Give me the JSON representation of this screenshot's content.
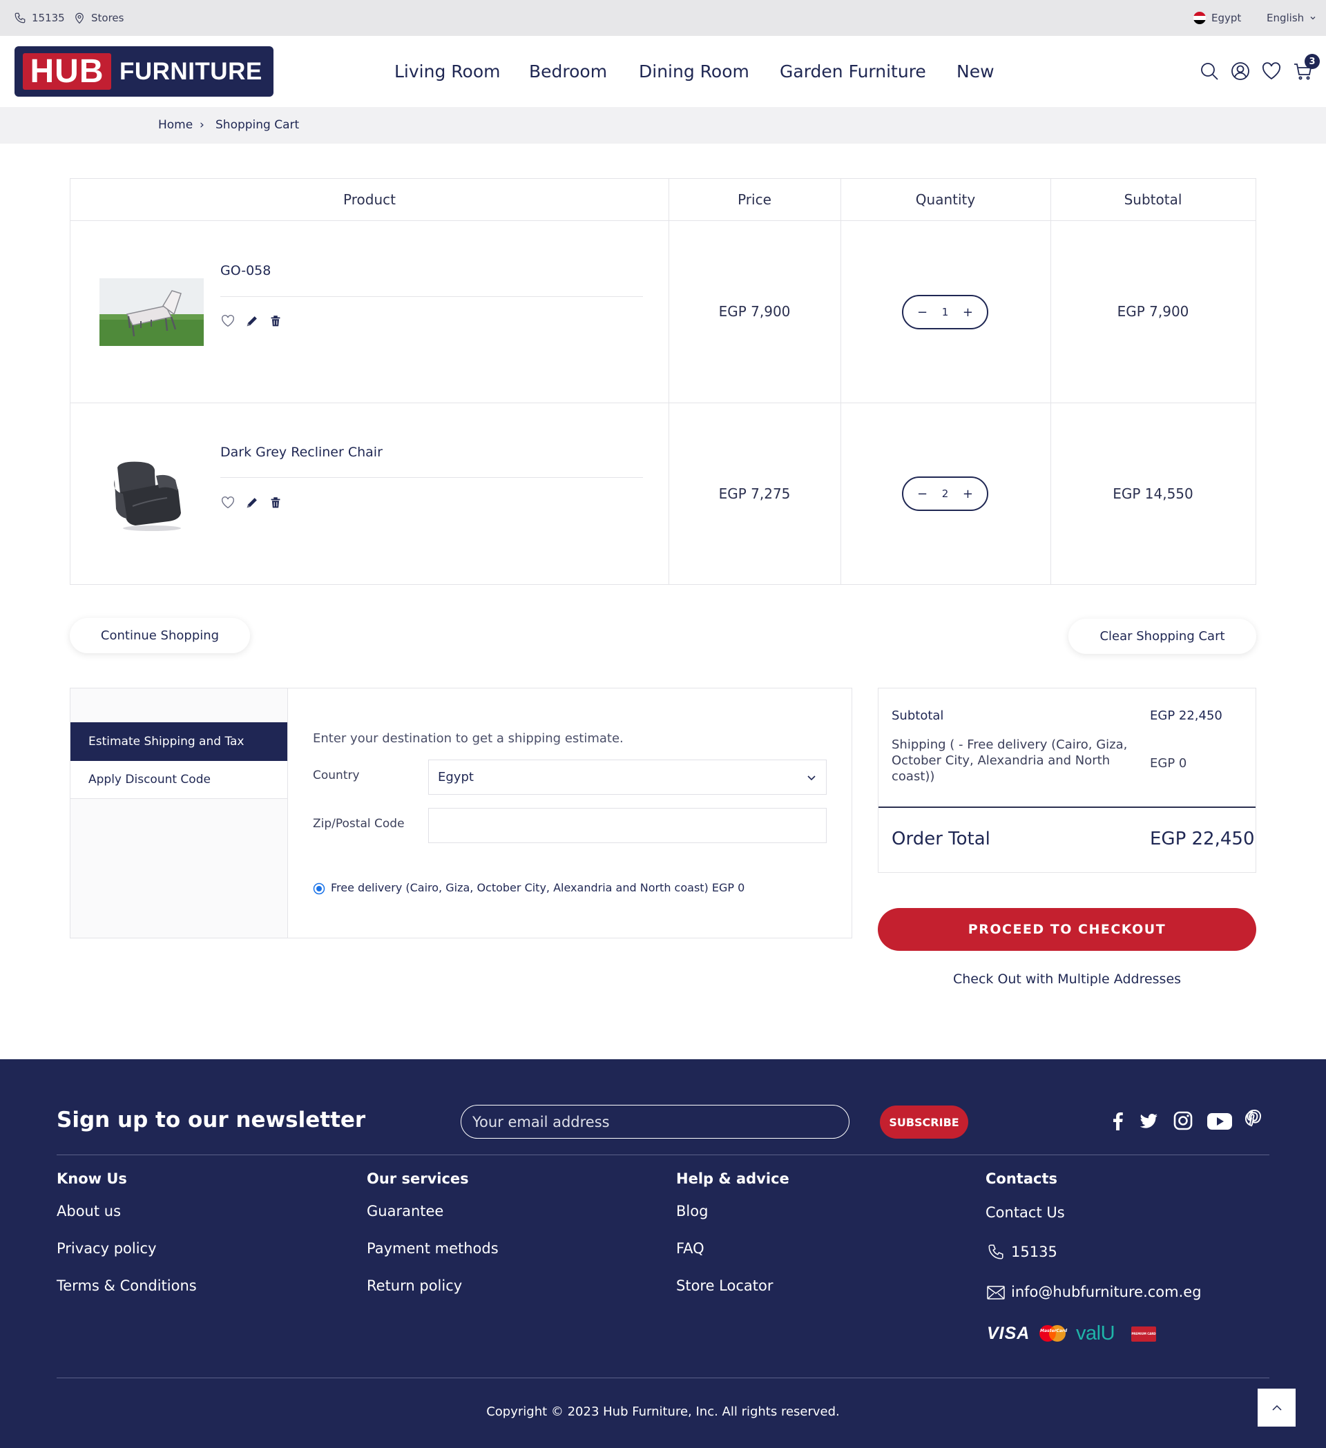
{
  "topbar": {
    "phone": "15135",
    "stores": "Stores",
    "country": "Egypt",
    "language": "English"
  },
  "header": {
    "logo_hub": "HUB",
    "logo_furniture": "FURNITURE",
    "nav": [
      "Living Room",
      "Bedroom",
      "Dining Room",
      "Garden Furniture",
      "New"
    ],
    "cart_count": "3",
    "icons": [
      "search-icon",
      "user-icon",
      "heart-icon",
      "cart-icon"
    ]
  },
  "breadcrumb": {
    "home": "Home",
    "separator": "›",
    "current": "Shopping Cart"
  },
  "cart": {
    "headers": {
      "product": "Product",
      "price": "Price",
      "quantity": "Quantity",
      "subtotal": "Subtotal"
    },
    "items": [
      {
        "name": "GO-058",
        "price": "EGP 7,900",
        "qty": "1",
        "subtotal": "EGP 7,900",
        "image": "lounge-chair-on-grass"
      },
      {
        "name": "Dark Grey Recliner Chair",
        "price": "EGP 7,275",
        "qty": "2",
        "subtotal": "EGP 14,550",
        "image": "dark-grey-recliner"
      }
    ],
    "continue": "Continue Shopping",
    "clear": "Clear Shopping Cart"
  },
  "shipping": {
    "tab_estimate": "Estimate Shipping and Tax",
    "tab_discount": "Apply Discount Code",
    "intro": "Enter your destination to get a shipping estimate.",
    "country_label": "Country",
    "country_value": "Egypt",
    "zip_label": "Zip/Postal Code",
    "zip_value": "",
    "option": "Free delivery (Cairo, Giza, October City, Alexandria and North coast) EGP 0"
  },
  "summary": {
    "subtotal_label": "Subtotal",
    "subtotal_value": "EGP 22,450",
    "shipping_label": "Shipping ( - Free delivery (Cairo, Giza, October City, Alexandria and North coast))",
    "shipping_value": "EGP 0",
    "total_label": "Order Total",
    "total_value": "EGP 22,450",
    "checkout": "PROCEED TO CHECKOUT",
    "multi": "Check Out with Multiple Addresses"
  },
  "footer": {
    "newsletter_title": "Sign up to our newsletter",
    "email_placeholder": "Your email address",
    "subscribe": "SUBSCRIBE",
    "social": [
      "facebook-icon",
      "twitter-icon",
      "instagram-icon",
      "youtube-icon",
      "pinterest-icon"
    ],
    "cols": [
      {
        "title": "Know Us",
        "links": [
          "About us",
          "Privacy policy",
          "Terms & Conditions"
        ]
      },
      {
        "title": "Our services",
        "links": [
          "Guarantee",
          "Payment methods",
          "Return policy"
        ]
      },
      {
        "title": "Help & advice",
        "links": [
          "Blog",
          "FAQ",
          "Store Locator"
        ]
      }
    ],
    "contacts": {
      "title": "Contacts",
      "contact_us": "Contact Us",
      "phone": "15135",
      "email": "info@hubfurniture.com.eg"
    },
    "payment": {
      "visa": "VISA",
      "mastercard": "MasterCard",
      "valu": "valU",
      "premium": "PREMIUM CARD"
    },
    "copyright": "Copyright © 2023 Hub Furniture, Inc. All rights reserved."
  },
  "colors": {
    "navy": "#1f2654",
    "red": "#c4202f",
    "topbar": "#e7e7e9"
  }
}
